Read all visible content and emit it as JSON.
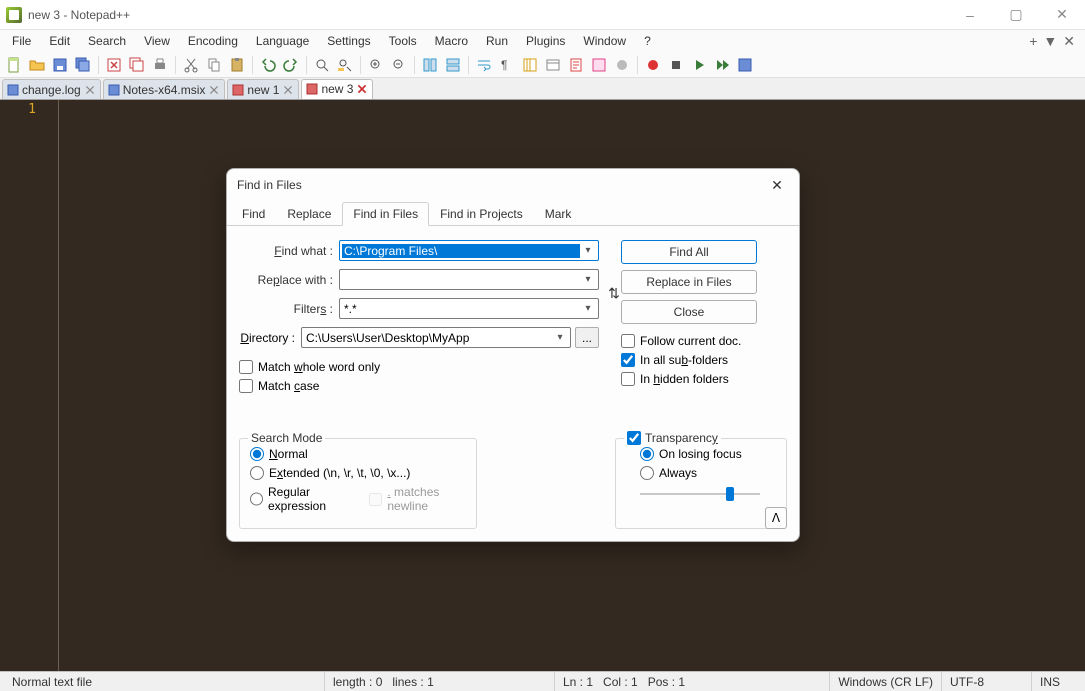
{
  "window": {
    "title": "new 3 - Notepad++"
  },
  "menu": {
    "items": [
      "File",
      "Edit",
      "Search",
      "View",
      "Encoding",
      "Language",
      "Settings",
      "Tools",
      "Macro",
      "Run",
      "Plugins",
      "Window",
      "?"
    ]
  },
  "tabs": [
    {
      "label": "change.log",
      "state": "saved"
    },
    {
      "label": "Notes-x64.msix",
      "state": "saved"
    },
    {
      "label": "new 1",
      "state": "unsaved"
    },
    {
      "label": "new 3",
      "state": "unsaved-active"
    }
  ],
  "editor": {
    "line_numbers": [
      "1"
    ]
  },
  "dialog": {
    "title": "Find in Files",
    "tabs": [
      "Find",
      "Replace",
      "Find in Files",
      "Find in Projects",
      "Mark"
    ],
    "active_tab": "Find in Files",
    "find_label": "Find what :",
    "find_value": "C:\\Program Files\\",
    "replace_label": "Replace with :",
    "replace_value": "",
    "filters_label": "Filters :",
    "filters_value": "*.*",
    "directory_label": "Directory :",
    "directory_value": "C:\\Users\\User\\Desktop\\MyApp",
    "browse_label": "...",
    "match_whole": "Match whole word only",
    "match_case": "Match case",
    "follow_current": "Follow current doc.",
    "sub_folders": "In all sub-folders",
    "hidden_folders": "In hidden folders",
    "buttons": {
      "find_all": "Find All",
      "replace_in_files": "Replace in Files",
      "close": "Close"
    },
    "search_mode": {
      "title": "Search Mode",
      "normal": "Normal",
      "extended": "Extended (\\n, \\r, \\t, \\0, \\x...)",
      "regex": "Regular expression",
      "matches_newline": ". matches newline"
    },
    "transparency": {
      "title": "Transparency",
      "on_losing": "On losing focus",
      "always": "Always"
    }
  },
  "status": {
    "file_type": "Normal text file",
    "length": "length : 0",
    "lines": "lines : 1",
    "ln": "Ln : 1",
    "col": "Col : 1",
    "pos": "Pos : 1",
    "eol": "Windows (CR LF)",
    "encoding": "UTF-8",
    "mode": "INS"
  }
}
